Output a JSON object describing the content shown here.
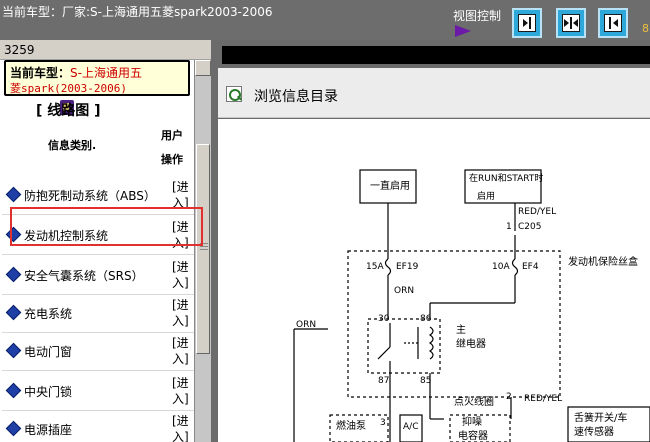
{
  "app": {
    "title": "当前车型：厂家:S-上海通用五菱spark2003-2006",
    "view_control_label": "视图控制",
    "edge_number": "8"
  },
  "left_panel": {
    "code": "3259",
    "vehicle_label": "当前车型：",
    "vehicle_value": "S-上海通用五",
    "vehicle_value_2": "菱spark(2003-2006)",
    "diagram_title": "[ 线路图 ]",
    "header_info": "信息类别.",
    "header_ops_1": "用户",
    "header_ops_2": "操作",
    "items": [
      {
        "name": "防抱死制动系统（ABS）",
        "enter1": "[进",
        "enter2": "入]"
      },
      {
        "name": "发动机控制系统",
        "enter1": "[进",
        "enter2": "入]"
      },
      {
        "name": "安全气囊系统（SRS）",
        "enter1": "[进",
        "enter2": "入]"
      },
      {
        "name": "充电系统",
        "enter1": "[进",
        "enter2": "入]"
      },
      {
        "name": "电动门窗",
        "enter1": "[进",
        "enter2": "入]"
      },
      {
        "name": "中央门锁",
        "enter1": "[进",
        "enter2": "入]"
      },
      {
        "name": "电源插座",
        "enter1": "[进",
        "enter2": "入]"
      }
    ],
    "selected_index": 1
  },
  "right_panel": {
    "browse_label": "浏览信息目录"
  },
  "diagram": {
    "box_always_on": "一直启用",
    "box_run_start_1": "在RUN和START时",
    "box_run_start_2": "启用",
    "wire_red_yel": "RED/YEL",
    "conn_c205": "C205",
    "pin_1": "1",
    "fuse_15a": "15A",
    "fuse_ef19": "EF19",
    "fuse_10a": "10A",
    "fuse_ef4": "EF4",
    "fuse_box_label": "发动机保险丝盒",
    "wire_orn_top": "ORN",
    "wire_orn_left": "ORN",
    "pin_30": "30",
    "pin_86": "86",
    "pin_87": "87",
    "pin_85": "85",
    "relay_label_1": "主",
    "relay_label_2": "继电器",
    "ignition_coil": "点火线圈",
    "pin_2": "2",
    "pin_3": "3",
    "wire_red_yel_2": "RED/YEL",
    "fuel_pump": "燃油泵",
    "ac_label": "A/C",
    "suppress_1": "抑噪",
    "suppress_2": "电容器",
    "tongue_switch_1": "舌簧开关/车",
    "tongue_switch_2": "速传感器"
  }
}
